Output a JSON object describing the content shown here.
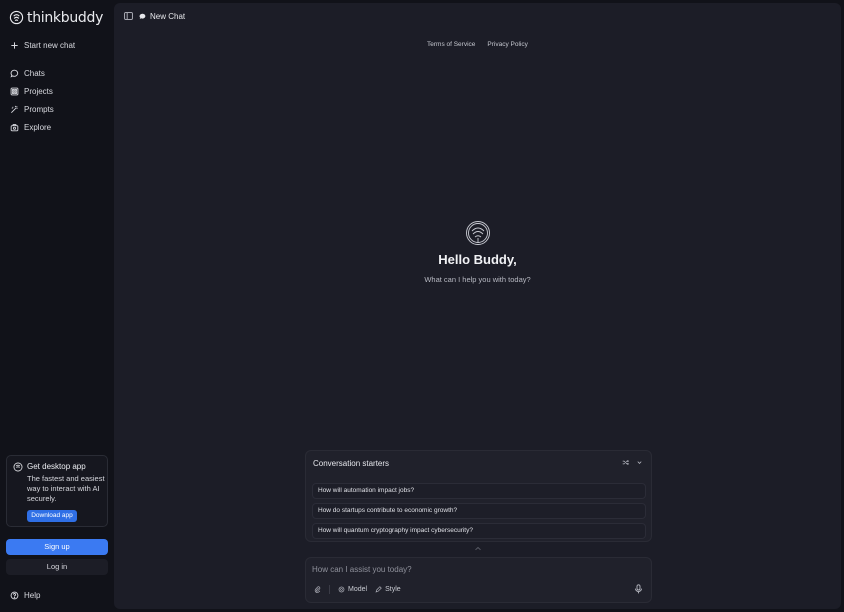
{
  "sidebar": {
    "brand": "thinkbuddy",
    "start_new_chat": "Start new chat",
    "items": [
      {
        "label": "Chats",
        "icon": "chat-bubble-icon"
      },
      {
        "label": "Projects",
        "icon": "grid-icon"
      },
      {
        "label": "Prompts",
        "icon": "wand-icon"
      },
      {
        "label": "Explore",
        "icon": "explore-icon"
      }
    ],
    "promo": {
      "title": "Get desktop app",
      "text": "The fastest and easiest way to interact with AI securely.",
      "button": "Download app"
    },
    "signup": "Sign up",
    "login": "Log in",
    "help": "Help"
  },
  "header": {
    "new_chat": "New Chat"
  },
  "links": {
    "terms": "Terms of Service",
    "privacy": "Privacy Policy"
  },
  "hero": {
    "greeting": "Hello Buddy,",
    "subtitle": "What can I help you with today?"
  },
  "starters": {
    "title": "Conversation starters",
    "items": [
      "How will automation impact jobs?",
      "How do startups contribute to economic growth?",
      "How will quantum cryptography impact cybersecurity?"
    ]
  },
  "composer": {
    "placeholder": "How can I assist you today?",
    "model_label": "Model",
    "style_label": "Style"
  },
  "colors": {
    "accent": "#3b7af2",
    "background": "#111219",
    "panel": "#1c1d27"
  }
}
